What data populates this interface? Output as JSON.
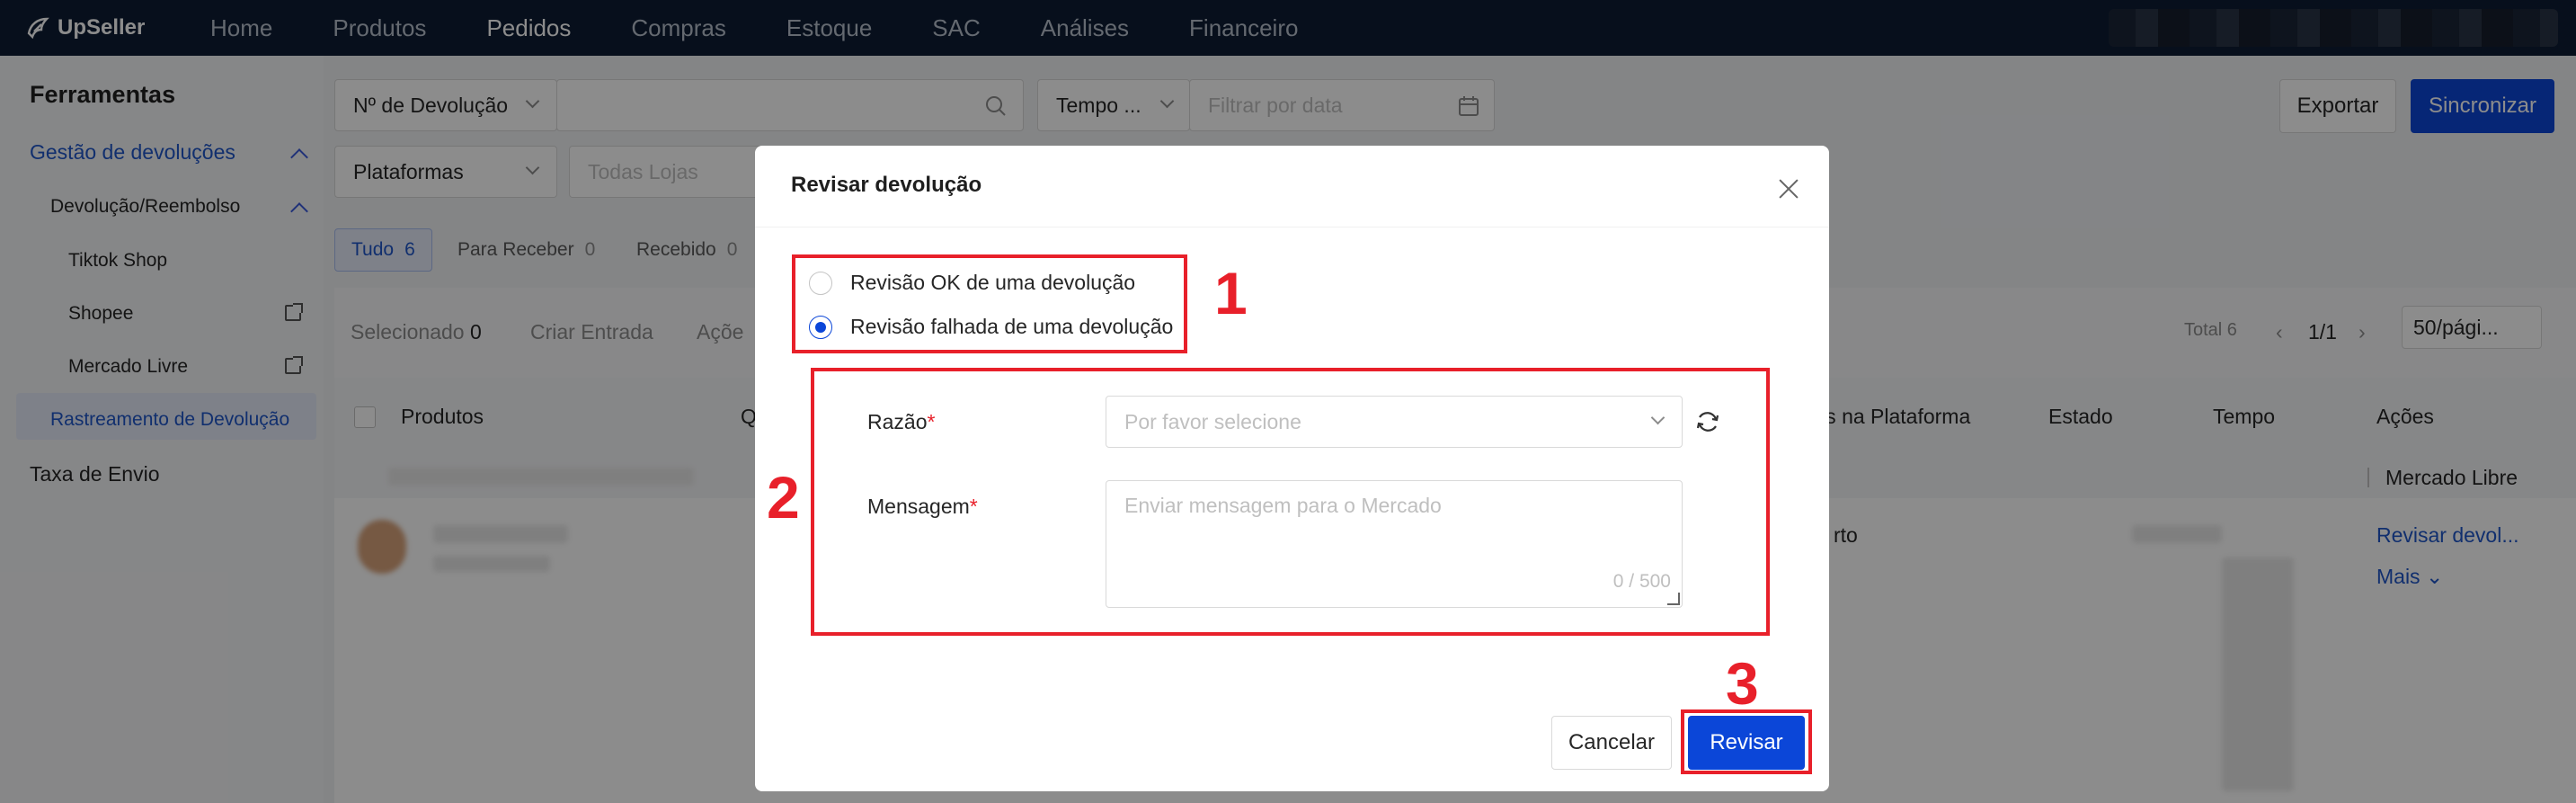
{
  "brand": {
    "name": "UpSeller"
  },
  "topnav": {
    "items": [
      "Home",
      "Produtos",
      "Pedidos",
      "Compras",
      "Estoque",
      "SAC",
      "Análises",
      "Financeiro"
    ],
    "active_index": 2
  },
  "sidebar": {
    "title": "Ferramentas",
    "group": "Gestão de devoluções",
    "subgroup": "Devolução/Reembolso",
    "items": [
      "Tiktok Shop",
      "Shopee",
      "Mercado Livre"
    ],
    "active_item": "Rastreamento de Devolução",
    "bottom": "Taxa de Envio"
  },
  "filters": {
    "type_select": "Nº de Devolução",
    "time_select": "Tempo ...",
    "date_placeholder": "Filtrar por data",
    "platform_select": "Plataformas",
    "store_placeholder": "Todas Lojas"
  },
  "actions": {
    "export": "Exportar",
    "sync": "Sincronizar"
  },
  "tabs": [
    {
      "label": "Tudo",
      "count": "6"
    },
    {
      "label": "Para Receber",
      "count": "0"
    },
    {
      "label": "Recebido",
      "count": "0"
    }
  ],
  "toolbar": {
    "selected_label": "Selecionado",
    "selected_count": "0",
    "create_entry": "Criar Entrada",
    "actions": "Açõe",
    "total": "Total 6",
    "page": "1/1",
    "page_size": "50/pági..."
  },
  "table": {
    "headers": {
      "products": "Produtos",
      "q": "Q",
      "platform_status": "tus na Plataforma",
      "state": "Estado",
      "time": "Tempo",
      "actions": "Ações"
    },
    "group_label": "Mercado Libre",
    "row": {
      "status_fragment": "rto",
      "review_link": "Revisar devol...",
      "more_link": "Mais"
    }
  },
  "modal": {
    "title": "Revisar devolução",
    "radio_ok": "Revisão OK de uma devolução",
    "radio_fail": "Revisão falhada de uma devolução",
    "reason_label": "Razão",
    "reason_placeholder": "Por favor selecione",
    "message_label": "Mensagem",
    "message_placeholder": "Enviar mensagem para o Mercado",
    "counter": "0 / 500",
    "required_mark": "*",
    "cancel": "Cancelar",
    "submit": "Revisar"
  },
  "annotations": {
    "step1": "1",
    "step2": "2",
    "step3": "3",
    "color": "#e8202a"
  },
  "colors": {
    "nav_bg": "#0d1c33",
    "primary": "#0b46d8",
    "link": "#1f56c9"
  }
}
